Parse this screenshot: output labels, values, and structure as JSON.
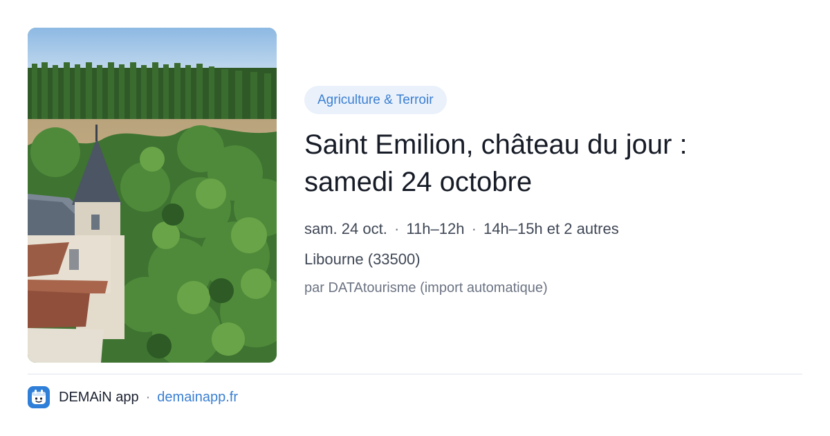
{
  "event": {
    "category": "Agriculture & Terroir",
    "title": "Saint Emilion, château du jour : samedi 24 octobre",
    "date": "sam. 24 oct.",
    "times": [
      "11h–12h",
      "14h–15h et 2 autres"
    ],
    "separator": "·",
    "location": "Libourne (33500)",
    "source": "par DATAtourisme (import automatique)"
  },
  "photo": {
    "icon": "photo-chateau-river-icon"
  },
  "footer": {
    "app_icon": "calendar-face-icon",
    "app_name": "DEMAiN app",
    "separator": "·",
    "url": "demainapp.fr"
  },
  "colors": {
    "accent": "#3a7fd2",
    "chip_background": "#eaf1fb",
    "title": "#161b26",
    "muted": "#6b7382"
  }
}
